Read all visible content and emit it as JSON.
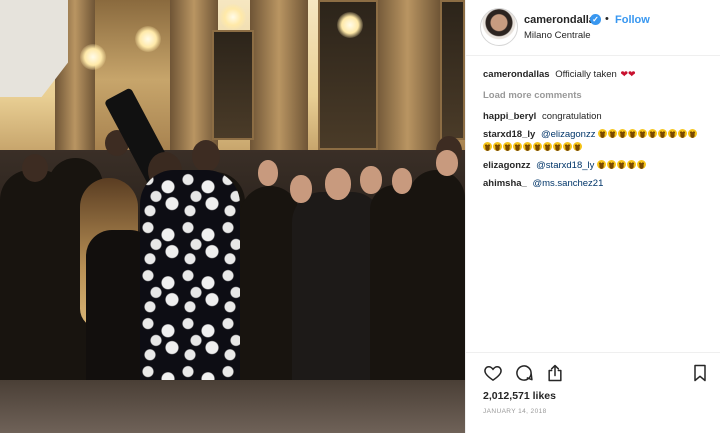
{
  "post": {
    "username": "camerondallas",
    "follow_label": "Follow",
    "separator": "•",
    "verified_mark": "✓",
    "location": "Milano Centrale",
    "likes": "2,012,571 likes",
    "date": "JANUARY 14, 2018"
  },
  "caption": {
    "username": "camerondallas",
    "text": "Officially taken",
    "emoji": "❤❤"
  },
  "load_more": "Load more comments",
  "comments": [
    {
      "username": "happi_beryl",
      "mention": "",
      "text": "congratulation"
    },
    {
      "username": "starxd18_ly",
      "mention": "@elizagonzz",
      "text": ""
    },
    {
      "username": "elizagonzz",
      "mention": "@starxd18_ly",
      "text": ""
    },
    {
      "username": "ahimsha_",
      "mention": "@ms.sanchez21",
      "text": ""
    }
  ],
  "icons": {
    "like": "heart-icon",
    "comment": "comment-icon",
    "share": "share-icon",
    "save": "bookmark-icon",
    "verified": "verified-badge-icon",
    "laugh_emoji": "laughing-emoji-icon"
  },
  "colors": {
    "accent": "#3897f0",
    "mention": "#003569",
    "muted": "#999999",
    "heart": "#c8102e"
  }
}
